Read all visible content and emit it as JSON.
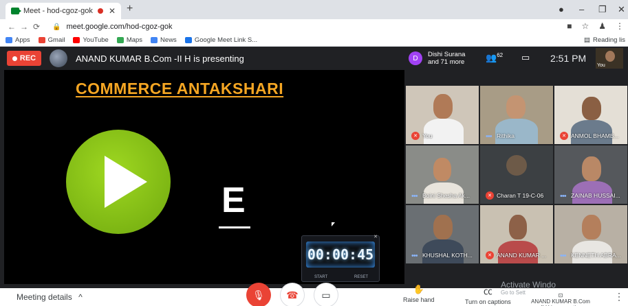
{
  "browser": {
    "tab_title": "Meet - hod-cgoz-gok",
    "url": "meet.google.com/hod-cgoz-gok",
    "bookmarks": [
      {
        "label": "Apps",
        "color": "#4285f4"
      },
      {
        "label": "Gmail",
        "color": "#ea4335"
      },
      {
        "label": "YouTube",
        "color": "#ff0000"
      },
      {
        "label": "Maps",
        "color": "#34a853"
      },
      {
        "label": "News",
        "color": "#4285f4"
      },
      {
        "label": "Google Meet Link S...",
        "color": "#1a73e8"
      }
    ],
    "reading_list": "Reading lis"
  },
  "presentation_bar": {
    "rec_label": "REC",
    "presenter_text": "ANAND KUMAR B.Com -II H is presenting"
  },
  "slide": {
    "title": "COMMERCE ANTAKSHARI",
    "letter": "E",
    "timer": {
      "display": "00:00:45",
      "start_label": "START",
      "reset_label": "RESET"
    }
  },
  "header_right": {
    "avatar_letter": "D",
    "participants_text": "Dishi Surana and 71 more",
    "people_count": "62",
    "time": "2:51 PM",
    "self_label": "You"
  },
  "tiles": [
    {
      "name": "You",
      "muted": true
    },
    {
      "name": "Rithika",
      "muted": false
    },
    {
      "name": "ANMOL BHAMB...",
      "muted": true
    },
    {
      "name": "Boini Shesha Ak...",
      "muted": false
    },
    {
      "name": "Charan T 19-C-06",
      "muted": true
    },
    {
      "name": "ZAINAB HUSSAI...",
      "muted": false
    },
    {
      "name": "KHUSHAL KOTH...",
      "muted": false
    },
    {
      "name": "ANAND KUMAR ...",
      "muted": true
    },
    {
      "name": "KENNETH ABRA...",
      "muted": false
    }
  ],
  "controls": {
    "meeting_details": "Meeting details",
    "raise_hand": "Raise hand",
    "captions": "Turn on captions",
    "activate_windows": "Activate Windo",
    "activate_sub": "Go to Sett",
    "presenting_note": "ANAND KUMAR B.Com -II H is presenting"
  }
}
